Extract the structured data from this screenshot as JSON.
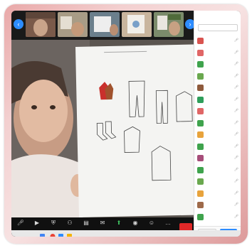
{
  "gallery": {
    "thumbs": [
      {
        "bg": "#8a6a5a"
      },
      {
        "bg": "#9a8f7a"
      },
      {
        "bg": "#6b7f8c"
      },
      {
        "bg": "#b9a48f"
      },
      {
        "bg": "#7b8b6b"
      }
    ],
    "prev": "‹",
    "next": "›"
  },
  "main": {
    "badge": "",
    "paper": {
      "title_lines": [
        "",
        "",
        ""
      ]
    }
  },
  "toolbar": {
    "items": [
      {
        "label": "",
        "icon": "mic-icon"
      },
      {
        "label": "",
        "icon": "video-icon"
      },
      {
        "label": "",
        "icon": "shield-icon"
      },
      {
        "label": "",
        "icon": "participants-icon"
      },
      {
        "label": "",
        "icon": "poll-icon"
      },
      {
        "label": "",
        "icon": "chat-icon"
      },
      {
        "label": "",
        "icon": "share-screen-icon"
      },
      {
        "label": "",
        "icon": "record-icon"
      },
      {
        "label": "",
        "icon": "reactions-icon"
      },
      {
        "label": "",
        "icon": "more-icon"
      }
    ],
    "end_label": ""
  },
  "panel": {
    "title": "",
    "search_placeholder": "",
    "participants": [
      {
        "name": "",
        "color": "#d9534f"
      },
      {
        "name": "",
        "color": "#e06666"
      },
      {
        "name": "",
        "color": "#3fa34d"
      },
      {
        "name": "",
        "color": "#6aa84f"
      },
      {
        "name": "",
        "color": "#8e5a3c"
      },
      {
        "name": "",
        "color": "#2e9e5a"
      },
      {
        "name": "",
        "color": "#e06666"
      },
      {
        "name": "",
        "color": "#3fa34d"
      },
      {
        "name": "",
        "color": "#e8a33c"
      },
      {
        "name": "",
        "color": "#3fa34d"
      },
      {
        "name": "",
        "color": "#a64d79"
      },
      {
        "name": "",
        "color": "#3fa34d"
      },
      {
        "name": "",
        "color": "#6aa84f"
      },
      {
        "name": "",
        "color": "#e8a33c"
      },
      {
        "name": "",
        "color": "#9e6a4a"
      },
      {
        "name": "",
        "color": "#3fa34d"
      }
    ],
    "footer": {
      "left_button": "",
      "right_button": ""
    }
  }
}
